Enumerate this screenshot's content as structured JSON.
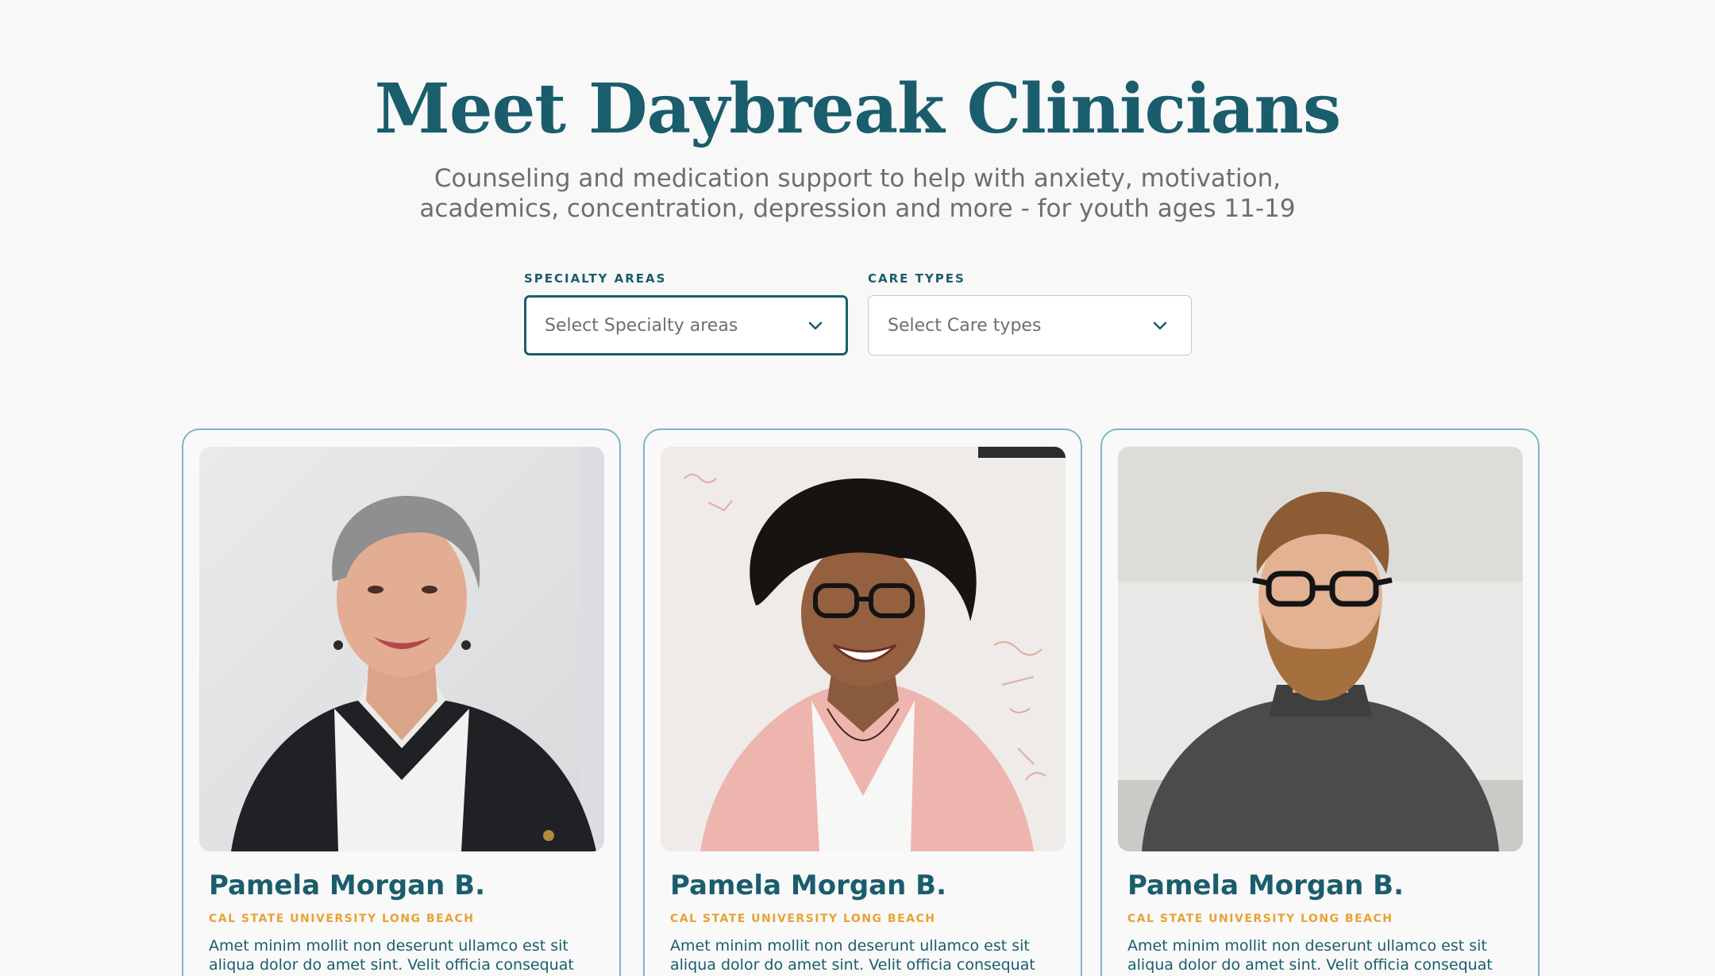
{
  "hero": {
    "title": "Meet Daybreak Clinicians",
    "subtitle": "Counseling and medication support to help with anxiety, motivation, academics, concentration, depression and more - for youth ages 11-19"
  },
  "filters": {
    "specialty": {
      "label": "SPECIALTY AREAS",
      "placeholder": "Select Specialty areas"
    },
    "care": {
      "label": "CARE TYPES",
      "placeholder": "Select Care types"
    }
  },
  "clinicians": [
    {
      "name": "Pamela Morgan B.",
      "school": "CAL STATE UNIVERSITY LONG BEACH",
      "bio": "Amet minim mollit non deserunt ullamco est sit aliqua dolor do amet sint. Velit officia consequat duis enim velit mollit. Exercitation veniam consequat sunt"
    },
    {
      "name": "Pamela Morgan B.",
      "school": "CAL STATE UNIVERSITY LONG BEACH",
      "bio": "Amet minim mollit non deserunt ullamco est sit aliqua dolor do amet sint. Velit officia consequat duis enim velit mollit. Exercitation veniam consequat sunt"
    },
    {
      "name": "Pamela Morgan B.",
      "school": "CAL STATE UNIVERSITY LONG BEACH",
      "bio": "Amet minim mollit non deserunt ullamco est sit aliqua dolor do amet sint. Velit officia consequat duis enim velit mollit. Exercitation veniam consequat sunt"
    }
  ],
  "colors": {
    "primary": "#1a5d6c",
    "accent": "#e7a334",
    "muted_text": "#6e6e72",
    "card_border": "#7bb6c2",
    "background": "#f8f8f8"
  },
  "icons": {
    "dropdown": "chevron-down-icon"
  }
}
